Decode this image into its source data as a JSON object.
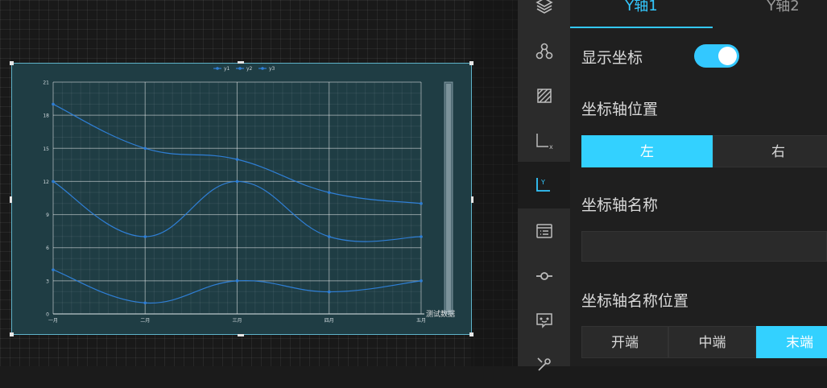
{
  "panel": {
    "tabs": [
      {
        "label": "Y轴1",
        "active": true
      },
      {
        "label": "Y轴2",
        "active": false
      }
    ],
    "show_axis": {
      "label": "显示坐标",
      "enabled": true
    },
    "axis_position": {
      "label": "坐标轴位置",
      "options": [
        "左",
        "右"
      ],
      "selected": "左"
    },
    "axis_name": {
      "label": "坐标轴名称",
      "value": "",
      "placeholder": ""
    },
    "axis_name_position": {
      "label": "坐标轴名称位置",
      "options": [
        "开端",
        "中端",
        "末端"
      ],
      "selected": "末端"
    }
  },
  "icon_rail": {
    "items": [
      {
        "icon": "layers-icon"
      },
      {
        "icon": "nodes-icon"
      },
      {
        "icon": "area-pattern-icon"
      },
      {
        "icon": "x-axis-icon"
      },
      {
        "icon": "y-axis-icon",
        "active": true
      },
      {
        "icon": "list-icon"
      },
      {
        "icon": "line-point-icon"
      },
      {
        "icon": "tooltip-icon"
      },
      {
        "icon": "tools-icon"
      }
    ]
  },
  "colors": {
    "accent": "#33c8ff",
    "chart_bg": "#1f3d44",
    "chart_line": "#2f7fd6"
  },
  "chart_data": {
    "type": "line",
    "categories": [
      "一月",
      "二月",
      "三月",
      "四月",
      "五月"
    ],
    "series": [
      {
        "name": "y1",
        "values": [
          19,
          15,
          14,
          11,
          10
        ]
      },
      {
        "name": "y2",
        "values": [
          12,
          7,
          12,
          7,
          7
        ]
      },
      {
        "name": "y3",
        "values": [
          4,
          1,
          3,
          2,
          3
        ]
      }
    ],
    "ylim": [
      0,
      21
    ],
    "yticks": [
      "0",
      "3",
      "6",
      "9",
      "12",
      "15",
      "18",
      "21"
    ],
    "xlabel": "测试数据",
    "ylabel": "",
    "smooth": true,
    "grid": true,
    "legend": "top-center",
    "data_zoom": "right"
  }
}
